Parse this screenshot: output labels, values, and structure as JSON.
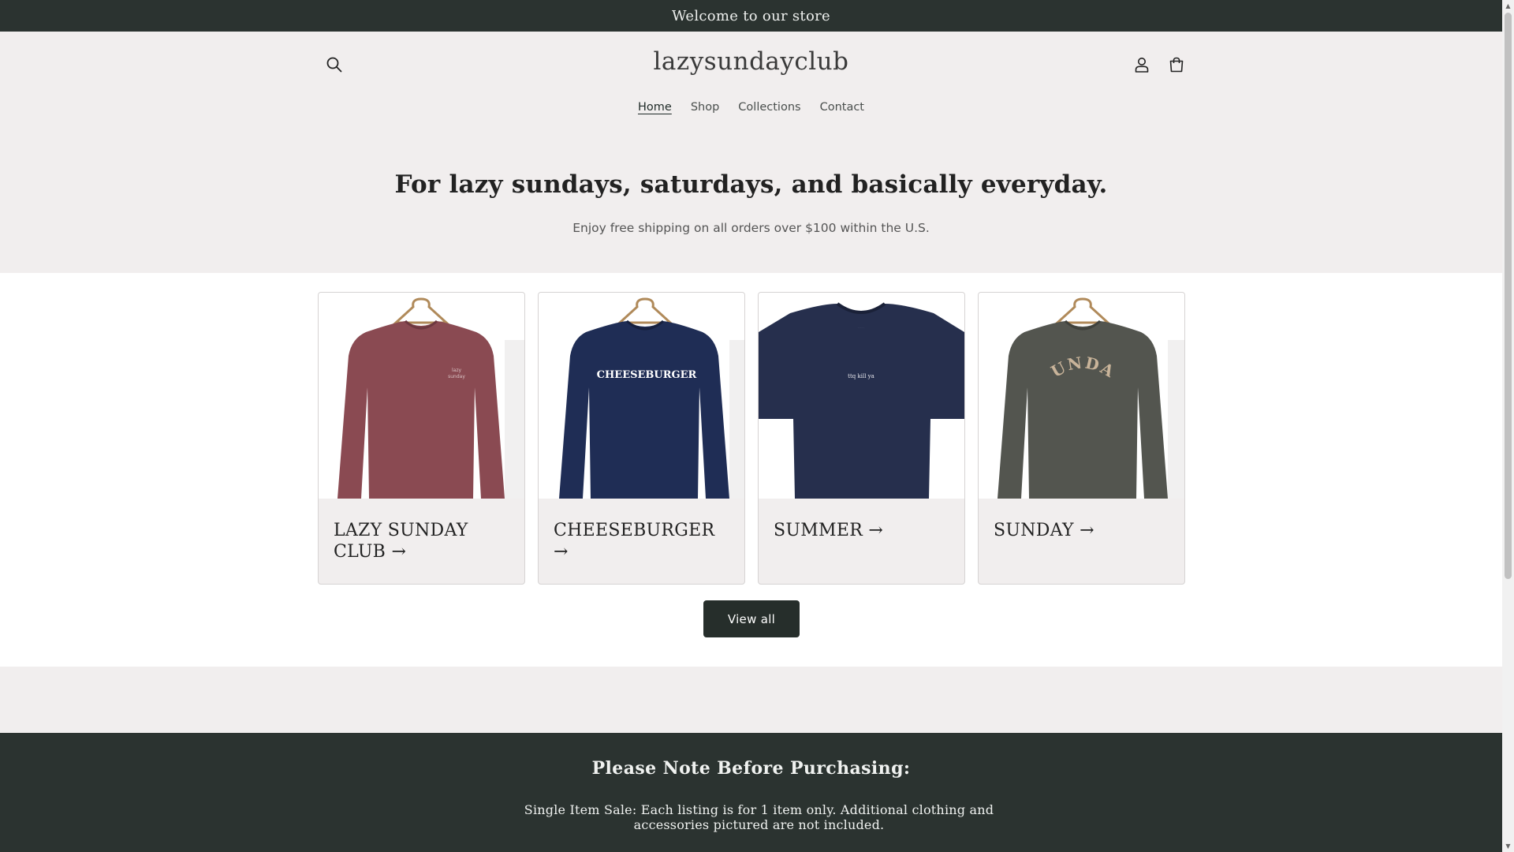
{
  "announcement": {
    "text": "Welcome to our store"
  },
  "header": {
    "logo": "lazysundayclub",
    "icons": {
      "search": "search-icon",
      "account": "account-icon",
      "cart": "cart-icon"
    },
    "nav": [
      {
        "label": "Home",
        "active": true
      },
      {
        "label": "Shop",
        "active": false
      },
      {
        "label": "Collections",
        "active": false
      },
      {
        "label": "Contact",
        "active": false
      }
    ]
  },
  "hero": {
    "title": "For lazy sundays, saturdays, and basically everyday.",
    "subtitle": "Enjoy free shipping on all orders over $100 within the U.S."
  },
  "collections": [
    {
      "title": "LAZY SUNDAY CLUB →",
      "color": "#8a4a52",
      "garment": "sweatshirt",
      "print": ""
    },
    {
      "title": "CHEESEBURGER →",
      "color": "#1f2d55",
      "garment": "sweatshirt",
      "print": "CHEESEBURGER"
    },
    {
      "title": "SUMMER →",
      "color": "#262f4d",
      "garment": "tshirt",
      "print": "ttq kill ya"
    },
    {
      "title": "SUNDAY →",
      "color": "#53554f",
      "garment": "sweatshirt",
      "print": "SUNDAY"
    }
  ],
  "view_all": {
    "label": "View all"
  },
  "note": {
    "title": "Please Note Before Purchasing:",
    "body": "Single Item Sale: Each listing is for 1 item only. Additional clothing and accessories pictured are not included."
  },
  "colors": {
    "dark": "#2b3330",
    "light_bg": "#f1eeee",
    "button": "#262e2b"
  }
}
